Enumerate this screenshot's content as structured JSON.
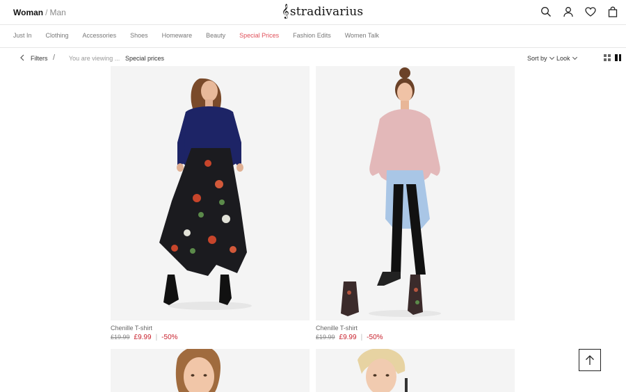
{
  "header": {
    "gender": {
      "woman": "Woman",
      "separator": "/",
      "man": "Man"
    },
    "logo": {
      "clef": "𝄞",
      "text": "stradivarius"
    },
    "icons": [
      "search-icon",
      "user-icon",
      "heart-icon",
      "bag-icon"
    ]
  },
  "nav": {
    "items": [
      {
        "label": "Just In"
      },
      {
        "label": "Clothing"
      },
      {
        "label": "Accessories"
      },
      {
        "label": "Shoes"
      },
      {
        "label": "Homeware"
      },
      {
        "label": "Beauty"
      },
      {
        "label": "Special Prices"
      },
      {
        "label": "Fashion Edits"
      },
      {
        "label": "Women Talk"
      }
    ],
    "active": "Special Prices",
    "active_color": "#e0505a"
  },
  "filterbar": {
    "filters_label": "Filters",
    "slash": "/",
    "viewing_label": "You are viewing ...",
    "viewing_value": "Special prices",
    "sort_label": "Sort by",
    "look_label": "Look"
  },
  "products": [
    {
      "name": "Chenille T-shirt",
      "old_price": "£19.99",
      "new_price": "£9.99",
      "discount": "-50%"
    },
    {
      "name": "Chenille T-shirt",
      "old_price": "£19.99",
      "new_price": "£9.99",
      "discount": "-50%"
    }
  ],
  "colors": {
    "sale_red": "#c8202c",
    "image_bg": "#f3f3f3"
  }
}
